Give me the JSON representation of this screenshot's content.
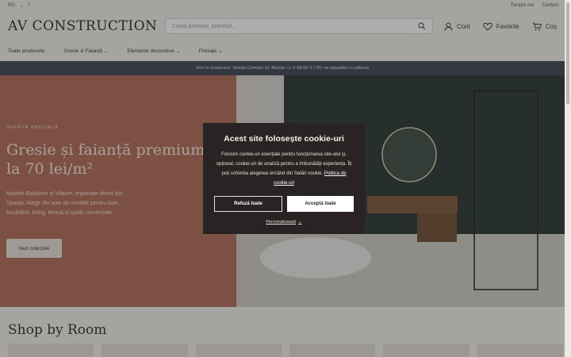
{
  "topbar": {
    "lang": "RO",
    "social_icon": "facebook-icon",
    "links": [
      "Despre noi",
      "Contact"
    ]
  },
  "header": {
    "logo": "AV CONSTRUCTION",
    "search_placeholder": "Caută produse, branduri...",
    "account_label": "Cont",
    "favorites_label": "Favorite",
    "cart_label": "Coș"
  },
  "nav": {
    "items": [
      "Toate produsele",
      "Gresie & Faianță",
      "Elemente decorative",
      "Finisaje"
    ]
  },
  "announcement": "Vino în showroom: Strada Cerbului 18, Bistrița • L-V 08:00–17:00 • te așteptăm cu plăcere",
  "hero": {
    "eyebrow": "OFERTĂ SPECIALĂ",
    "title": "Gresie și faianță premium de la 70 lei/m²",
    "text": "Modele Baldocer și Vitacer, importate direct din Spania. Alege din sute de modele pentru baie, bucătărie, living, terasă și spații comerciale.",
    "button": "Vezi colecțiile"
  },
  "section_title": "Shop by Room",
  "cookie": {
    "title": "Acest site folosește cookie-uri",
    "text": "Folosim cookie-uri esențiale pentru funcționarea site-ului și, opțional, cookie-uri de analiză pentru a îmbunătăți experiența. Îți poți schimba alegerea oricând din Setări cookie.",
    "policy_link": "Politica de cookie-uri",
    "refuse": "Refuză toate",
    "accept": "Acceptă toate",
    "personalize": "Personalizează"
  },
  "colors": {
    "hero_left": "#b06b55",
    "announce": "#3d4350",
    "cookie_bg": "#292423"
  }
}
